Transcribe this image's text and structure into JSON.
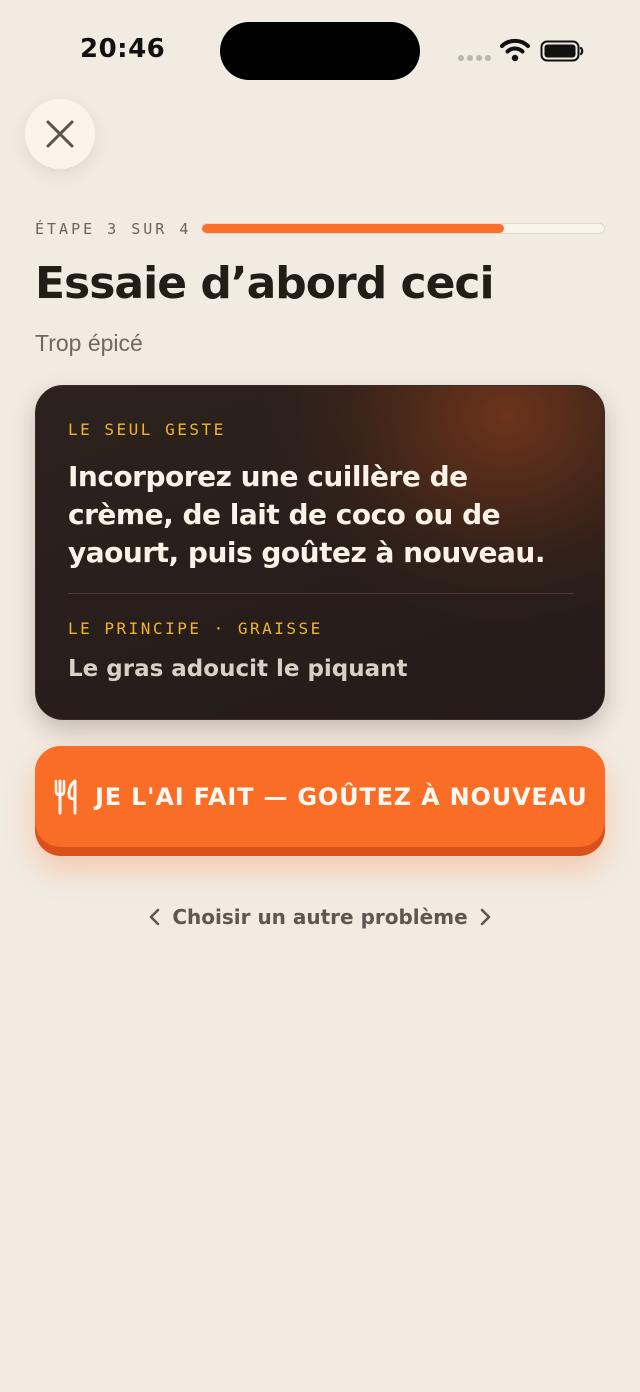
{
  "status_bar": {
    "time": "20:46"
  },
  "header": {
    "close_icon": "close-icon",
    "step_label": "ÉTAPE 3 SUR 4",
    "step_current": 3,
    "step_total": 4,
    "progress_fraction": 0.75,
    "title": "Essaie d’abord ceci",
    "subtitle": "Trop épicé"
  },
  "card": {
    "kicker": "LE SEUL GESTE",
    "action": "Incorporez une cuillère de crème, de lait de coco ou de yaourt, puis goûtez à nouveau.",
    "principle_kicker": "LE PRINCIPE · GRAISSE",
    "principle": "Le gras adoucit le piquant"
  },
  "primary_button": {
    "icon": "utensils-icon",
    "label": "JE L'AI FAIT — GOÛTEZ À NOUVEAU"
  },
  "secondary_link": {
    "label": "Choisir un autre problème",
    "left_icon": "chevron-left-icon",
    "right_icon": "chevron-right-icon"
  },
  "colors": {
    "background": "#f1ebe2",
    "accent": "#fa6d27",
    "card": "#271e1b",
    "kicker": "#f2b230"
  }
}
